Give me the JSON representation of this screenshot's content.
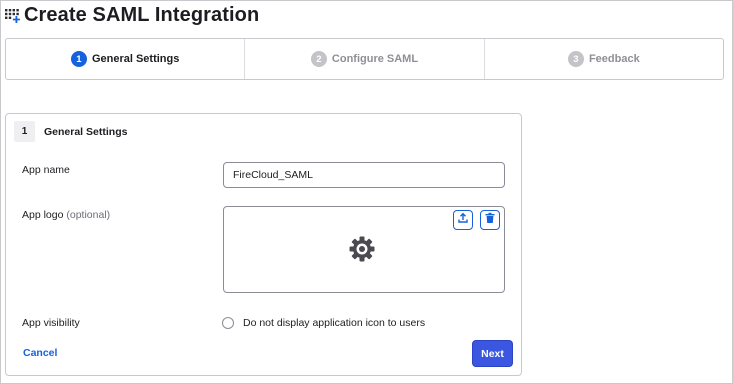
{
  "header": {
    "title": "Create SAML Integration",
    "icon": "app-grid-add-icon"
  },
  "stepper": {
    "steps": [
      {
        "number": "1",
        "label": "General Settings",
        "state": "active"
      },
      {
        "number": "2",
        "label": "Configure SAML",
        "state": "inactive"
      },
      {
        "number": "3",
        "label": "Feedback",
        "state": "inactive"
      }
    ]
  },
  "card": {
    "number": "1",
    "title": "General Settings"
  },
  "form": {
    "app_name": {
      "label": "App name",
      "value": "FireCloud_SAML"
    },
    "app_logo": {
      "label": "App logo",
      "optional": "(optional)",
      "upload_icon": "upload-icon",
      "delete_icon": "trash-icon",
      "placeholder_icon": "gear-icon"
    },
    "app_visibility": {
      "label": "App visibility",
      "option_label": "Do not display application icon to users",
      "checked": false
    }
  },
  "actions": {
    "cancel_label": "Cancel",
    "next_label": "Next"
  },
  "colors": {
    "accent": "#1662dd",
    "primary_button": "#3b56e0",
    "inactive_step": "#c4c4c8",
    "border": "#c9c9cd"
  }
}
